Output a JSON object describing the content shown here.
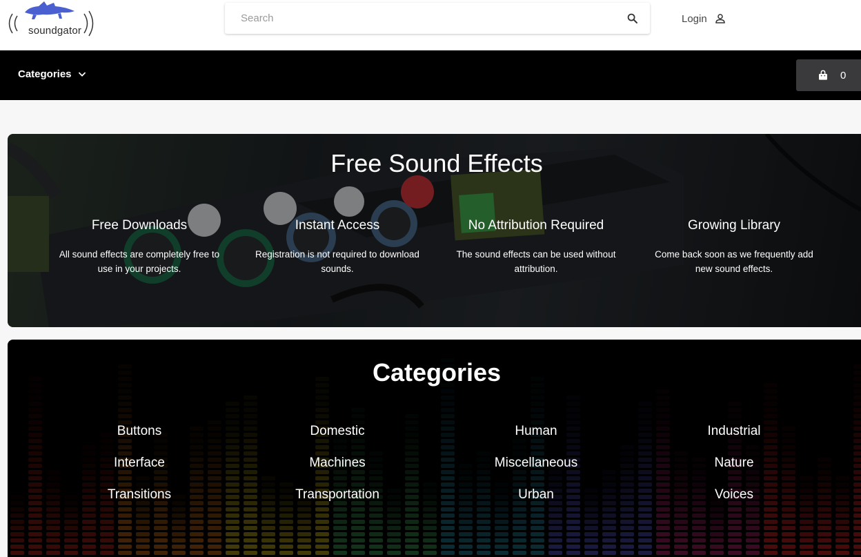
{
  "brand": {
    "name": "soundgator"
  },
  "search": {
    "placeholder": "Search"
  },
  "header": {
    "login_label": "Login"
  },
  "navbar": {
    "categories_label": "Categories",
    "cart_count": "0"
  },
  "hero": {
    "title": "Free Sound Effects",
    "features": [
      {
        "title": "Free Downloads",
        "desc": "All sound effects are completely free to use in your projects."
      },
      {
        "title": "Instant Access",
        "desc": "Registration is not required to download sounds."
      },
      {
        "title": "No Attribution Required",
        "desc": "The sound effects can be used without attribution."
      },
      {
        "title": "Growing Library",
        "desc": "Come back soon as we frequently add new sound effects."
      }
    ]
  },
  "categories": {
    "title": "Categories",
    "items": [
      "Buttons",
      "Domestic",
      "Human",
      "Industrial",
      "Interface",
      "Machines",
      "Miscellaneous",
      "Nature",
      "Transitions",
      "Transportation",
      "Urban",
      "Voices"
    ]
  },
  "colors": {
    "navbar": "#000000",
    "cart_bg": "#3a3a3c",
    "logo_blue": "#4a5fd0"
  },
  "icons": {
    "search": "search-icon",
    "login": "user-icon",
    "chevron": "chevron-down-icon",
    "cart": "shopping-bag-icon"
  }
}
